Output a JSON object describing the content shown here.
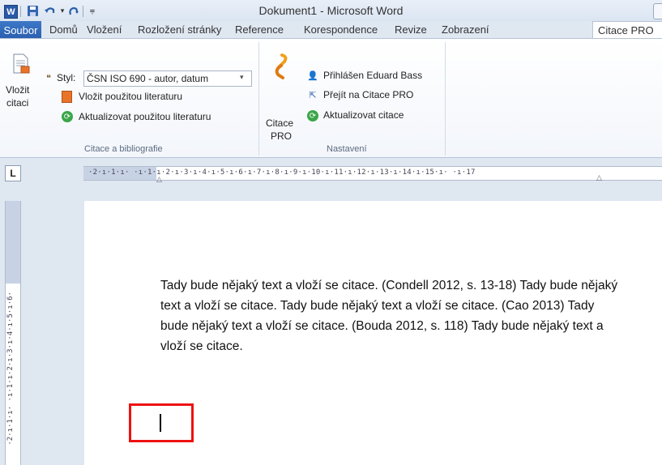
{
  "window": {
    "title": "Dokument1 - Microsoft Word",
    "app_icon": "word-icon"
  },
  "qat": {
    "save_icon": "save-icon",
    "undo_icon": "undo-icon",
    "redo_icon": "redo-icon"
  },
  "tabs": {
    "file": "Soubor",
    "items": [
      "Domů",
      "Vložení",
      "Rozložení stránky",
      "Reference",
      "Korespondence",
      "Revize",
      "Zobrazení",
      "Citace PRO"
    ],
    "active": "Citace PRO"
  },
  "ribbon": {
    "insert_citation": {
      "line1": "Vložit",
      "line2": "citaci"
    },
    "style_label": "Styl:",
    "style_value": "ČSN ISO 690 - autor, datum",
    "insert_bibliography": "Vložit použitou literaturu",
    "update_bibliography": "Aktualizovat použitou literaturu",
    "group1_label": "Citace a bibliografie",
    "citace_pro": {
      "line1": "Citace",
      "line2": "PRO"
    },
    "logged_in": "Přihlášen Eduard Bass",
    "go_to": "Přejít na Citace PRO",
    "update_citations": "Aktualizovat citace",
    "group2_label": "Nastavení"
  },
  "ruler": {
    "tab_selector": "L",
    "horizontal": "·2·ı·1·ı·  ·ı·1·ı·2·ı·3·ı·4·ı·5·ı·6·ı·7·ı·8·ı·9·ı·10·ı·11·ı·12·ı·13·ı·14·ı·15·ı·  ·ı·17",
    "vertical": "·2·ı·1·ı·  ·ı·1·ı·2·ı·3·ı·4·ı·5·ı·6·"
  },
  "document": {
    "paragraph": "Tady bude nějaký text a vloží se citace. (Condell 2012, s. 13-18) Tady bude nějaký text a vloží se citace. Tady bude nějaký text a vloží se citace. (Cao 2013) Tady bude nějaký text a vloží se citace. (Bouda 2012, s. 118) Tady bude nějaký text a vloží se citace."
  },
  "colors": {
    "file_tab": "#2a5fae",
    "highlight_box": "#ee1111",
    "ribbon_bg": "#ffffff",
    "chrome_bg": "#dfe7f1"
  }
}
